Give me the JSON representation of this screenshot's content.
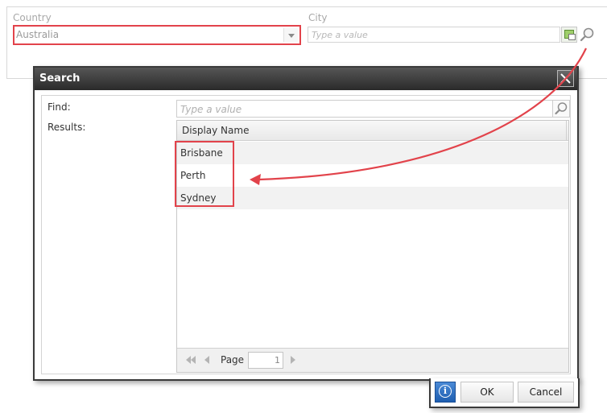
{
  "form": {
    "country_label": "Country",
    "country_value": "Australia",
    "city_label": "City",
    "city_placeholder": "Type a value"
  },
  "dialog": {
    "title": "Search",
    "find_label": "Find:",
    "find_placeholder": "Type a value",
    "results_label": "Results:",
    "grid": {
      "column_header": "Display Name",
      "rows": [
        "Brisbane",
        "Perth",
        "Sydney"
      ]
    },
    "pager": {
      "page_label": "Page",
      "page_value": "1"
    },
    "buttons": {
      "ok": "OK",
      "cancel": "Cancel"
    }
  },
  "icons": {
    "dropdown": "chevron-down-icon",
    "lookup": "lookup-icon",
    "search": "search-icon",
    "close": "close-icon",
    "info": "info-icon",
    "first_page": "first-page-icon",
    "prev_page": "prev-page-icon",
    "next_page": "next-page-icon"
  },
  "colors": {
    "highlight": "#e2434b",
    "titlebar": "#2a2a2a",
    "info_button": "#1d5db0"
  }
}
